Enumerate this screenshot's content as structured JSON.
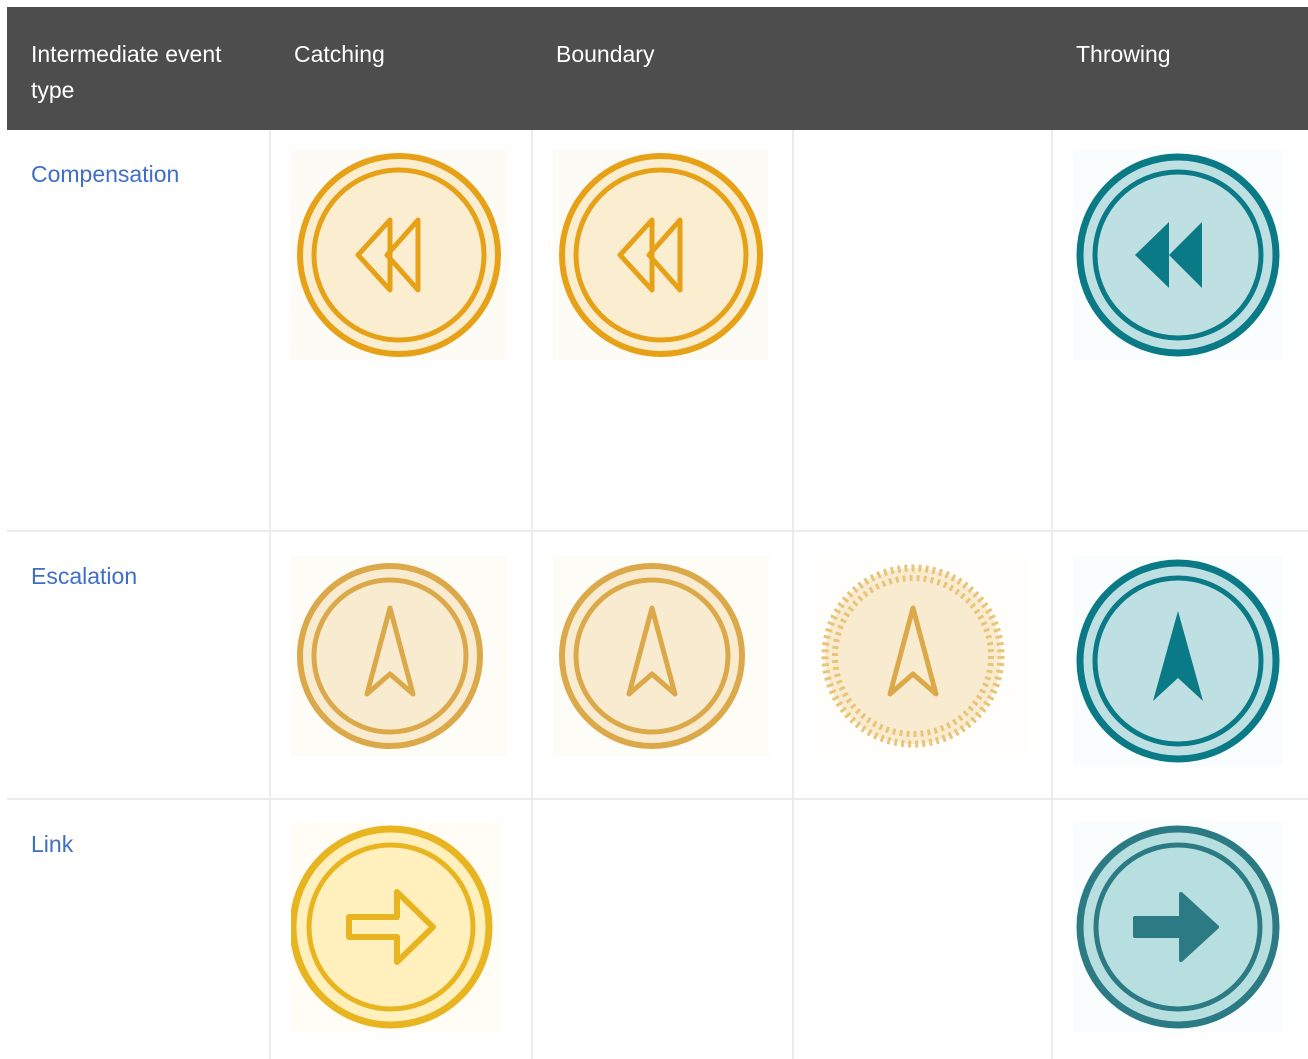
{
  "table": {
    "headers": [
      "Intermediate event type",
      "Catching",
      "Boundary",
      "",
      "Throwing"
    ],
    "rows": [
      {
        "label": "Compensation",
        "icons": [
          "compensation-catching-icon",
          "compensation-boundary-icon",
          null,
          "compensation-throwing-icon"
        ]
      },
      {
        "label": "Escalation",
        "icons": [
          "escalation-catching-icon",
          "escalation-boundary-interrupting-icon",
          "escalation-boundary-non-interrupting-icon",
          "escalation-throwing-icon"
        ]
      },
      {
        "label": "Link",
        "icons": [
          "link-catching-icon",
          null,
          null,
          "link-throwing-icon"
        ]
      }
    ]
  },
  "colors": {
    "header_bg": "#4d4d4d",
    "header_text": "#ffffff",
    "link_text": "#3f6ec6",
    "catching_stroke": "#e6a117",
    "catching_fill": "#fbedcf",
    "escalation_stroke": "#dca94a",
    "escalation_fill": "#f8ebcf",
    "link_catch_stroke": "#e8b420",
    "link_catch_fill": "#fff0bd",
    "throwing_stroke": "#0a7a86",
    "throwing_fill": "#bfe0e2",
    "link_throw_stroke": "#2b7a84",
    "link_throw_fill": "#b8dfe0",
    "grid": "#ebebeb"
  }
}
